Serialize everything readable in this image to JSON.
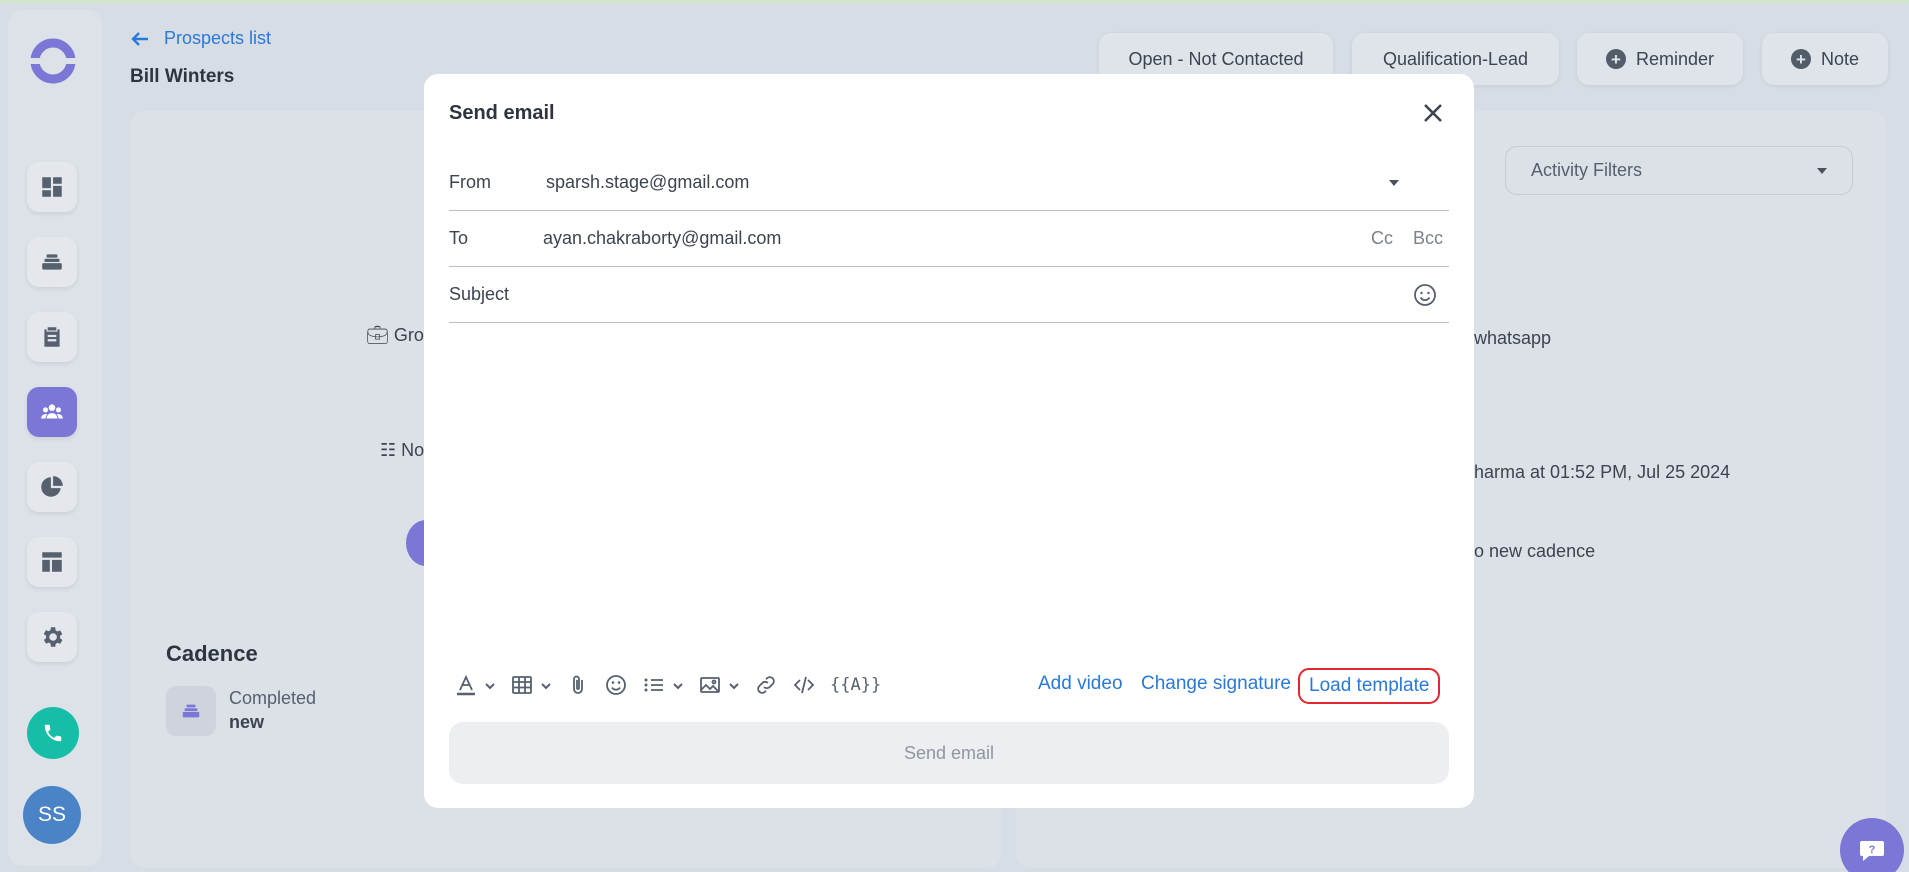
{
  "header": {
    "back_label": "Prospects list",
    "prospect_name": "Bill Winters",
    "status_pill": "Open - Not Contacted",
    "stage_pill": "Qualification-Lead",
    "reminder_label": "Reminder",
    "note_label": "Note"
  },
  "sidebar": {
    "avatar_initials": "SS",
    "items": [
      "dashboard-icon",
      "cadence-icon",
      "tasks-icon",
      "prospects-icon",
      "reports-icon",
      "templates-icon",
      "settings-icon"
    ]
  },
  "background": {
    "group_partial": "Grou",
    "note_partial": "No",
    "cadence_title": "Cadence",
    "cadence_status": "Completed",
    "cadence_name": "new",
    "activity_filters": "Activity Filters",
    "activity_1": "whatsapp",
    "activity_2": "harma at 01:52 PM, Jul 25 2024",
    "activity_3": "o new cadence"
  },
  "modal": {
    "title": "Send email",
    "from_label": "From",
    "from_value": "sparsh.stage@gmail.com",
    "to_label": "To",
    "to_value": "ayan.chakraborty@gmail.com",
    "cc_label": "Cc",
    "bcc_label": "Bcc",
    "subject_placeholder": "Subject",
    "merge_fields": "{{A}}",
    "add_video": "Add video",
    "change_signature": "Change signature",
    "load_template": "Load template",
    "send_label": "Send email"
  },
  "colors": {
    "accent": "#7b77d6",
    "link": "#2a79d8",
    "highlight_border": "#e0282e",
    "phone": "#16bea8"
  }
}
